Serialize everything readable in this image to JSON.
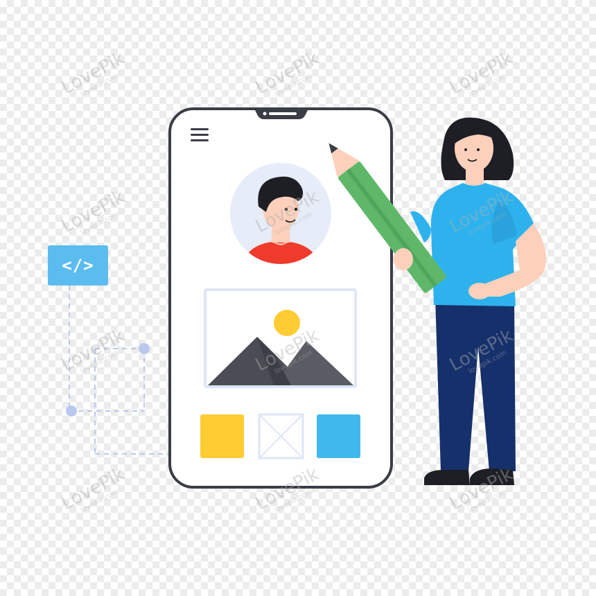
{
  "code_tag": {
    "label": "</>"
  },
  "watermark": {
    "brand": "LovePik",
    "url": "lovepik.com"
  },
  "colors": {
    "phone_outline": "#3a3d45",
    "phone_screen": "#ffffff",
    "avatar_bg": "#e6ecf8",
    "avatar_shirt": "#ef3b2c",
    "image_frame": "#dde6f6",
    "mountain": "#4b4d55",
    "sun": "#ffcc33",
    "swatch_yellow": "#ffcc33",
    "swatch_blue": "#40b8ee",
    "code_tag_bg": "#5bbcf0",
    "pencil_green": "#5fb86a",
    "shirt_blue": "#2eb2ee",
    "pants_navy": "#16306b",
    "hair": "#1d1f25",
    "skin": "#fcd0bb"
  }
}
